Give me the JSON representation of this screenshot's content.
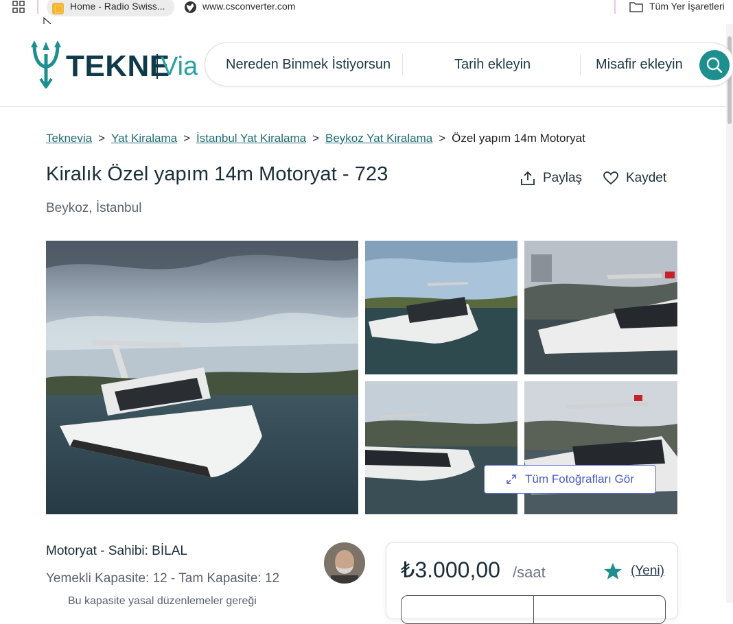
{
  "bookmarks": {
    "items": [
      {
        "label": "Home - Radio Swiss..."
      },
      {
        "label": "www.csconverter.com"
      }
    ],
    "folder_label": "Tüm Yer İşaretleri"
  },
  "header": {
    "logo_main": "TEKNE",
    "logo_sub": "Via",
    "search": {
      "where": "Nereden Binmek İstiyorsun",
      "date": "Tarih ekleyin",
      "guests": "Misafir ekleyin"
    }
  },
  "breadcrumb": {
    "links": [
      "Teknevia",
      "Yat Kiralama",
      "İstanbul Yat Kiralama",
      "Beykoz Yat Kiralama"
    ],
    "current": "Özel yapım 14m Motoryat",
    "separator": ">"
  },
  "listing": {
    "title": "Kiralık Özel yapım 14m Motoryat - 723",
    "location": "Beykoz, İstanbul",
    "share_label": "Paylaş",
    "save_label": "Kaydet",
    "all_photos_label": "Tüm Fotoğrafları Gör",
    "owner": "Motoryat - Sahibi: BİLAL",
    "capacity": "Yemekli Kapasite: 12 - Tam Kapasite: 12",
    "note": "Bu kapasite yasal düzenlemeler gereği"
  },
  "pricing": {
    "price": "₺3.000,00",
    "unit": "/saat",
    "badge": "(Yeni)"
  },
  "colors": {
    "brand_dark": "#0f3a4a",
    "brand_teal": "#1e8f8f",
    "link": "#1d6b73",
    "photos_button": "#4a5bc6"
  }
}
